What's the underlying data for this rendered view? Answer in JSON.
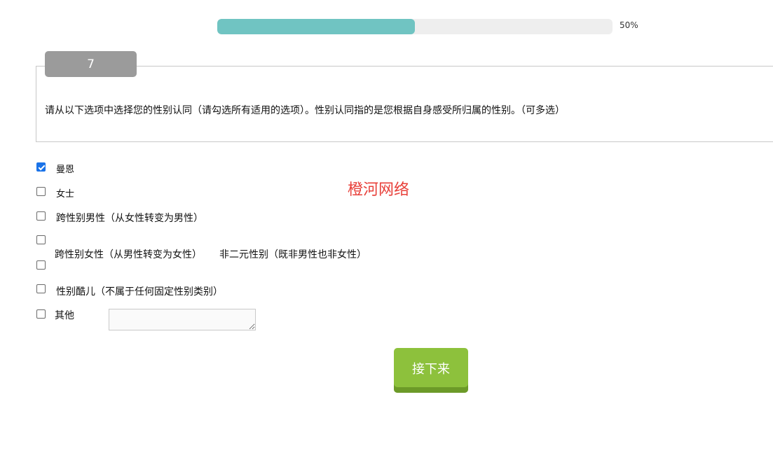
{
  "progress": {
    "value": 0.5,
    "label": "50%",
    "fill_color": "#70c4c2"
  },
  "question": {
    "number": "7",
    "text": "请从以下选项中选择您的性别认同（请勾选所有适用的选项）。性别认同指的是您根据自身感受所归属的性别。（可多选）"
  },
  "options": [
    {
      "label": "曼恩",
      "checked": true
    },
    {
      "label": "女士",
      "checked": false
    },
    {
      "label": "跨性别男性（从女性转变为男性）",
      "checked": false
    },
    {
      "label": "跨性别女性（从男性转变为女性）",
      "checked": false
    },
    {
      "label": "非二元性别（既非男性也非女性）",
      "checked": false
    },
    {
      "label": "性别酷儿（不属于任何固定性别类别）",
      "checked": false
    },
    {
      "label": "其他",
      "checked": false
    }
  ],
  "other_input": {
    "value": ""
  },
  "watermark": "橙河网络",
  "next_button": {
    "label": "接下来",
    "color": "#8dc13c"
  },
  "colors": {
    "accent": "#1a73e8",
    "watermark": "#e8403a"
  }
}
